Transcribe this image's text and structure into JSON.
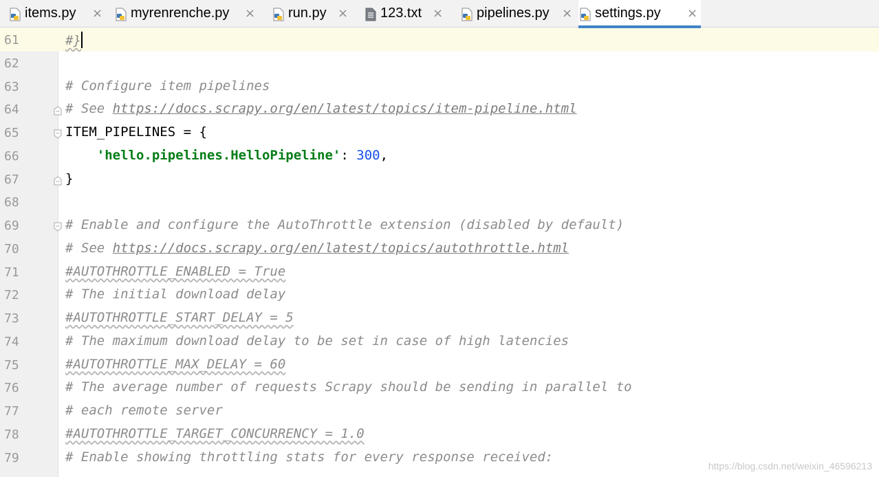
{
  "tabs": [
    {
      "label": "items.py",
      "icon": "python-file-icon",
      "active": false,
      "closable": true
    },
    {
      "label": "myrenrenche.py",
      "icon": "python-file-icon",
      "active": false,
      "closable": true
    },
    {
      "label": "run.py",
      "icon": "python-file-icon",
      "active": false,
      "closable": true
    },
    {
      "label": "123.txt",
      "icon": "text-file-icon",
      "active": false,
      "closable": true
    },
    {
      "label": "pipelines.py",
      "icon": "python-file-icon",
      "active": false,
      "closable": true
    },
    {
      "label": "settings.py",
      "icon": "python-file-icon",
      "active": true,
      "closable": true
    }
  ],
  "close_glyph": "×",
  "lines": [
    {
      "num": "61",
      "parts": [
        {
          "t": "#}",
          "c": "comment wavy"
        }
      ],
      "caret": true
    },
    {
      "num": "62",
      "parts": []
    },
    {
      "num": "63",
      "parts": [
        {
          "t": "# Configure item pipelines",
          "c": "comment"
        }
      ]
    },
    {
      "num": "64",
      "parts": [
        {
          "t": "# See ",
          "c": "comment"
        },
        {
          "t": "https://docs.scrapy.org/en/latest/topics/item-pipeline.html",
          "c": "url"
        }
      ],
      "fold": "end"
    },
    {
      "num": "65",
      "parts": [
        {
          "t": "ITEM_PIPELINES = {",
          "c": "plain"
        }
      ],
      "fold": "start"
    },
    {
      "num": "66",
      "parts": [
        {
          "t": "    ",
          "c": "plain"
        },
        {
          "t": "'hello.pipelines.HelloPipeline'",
          "c": "str"
        },
        {
          "t": ": ",
          "c": "plain"
        },
        {
          "t": "300",
          "c": "num"
        },
        {
          "t": ",",
          "c": "plain"
        }
      ]
    },
    {
      "num": "67",
      "parts": [
        {
          "t": "}",
          "c": "plain"
        }
      ],
      "fold": "end"
    },
    {
      "num": "68",
      "parts": []
    },
    {
      "num": "69",
      "parts": [
        {
          "t": "# Enable and configure the AutoThrottle extension (disabled by default)",
          "c": "comment"
        }
      ],
      "fold": "start"
    },
    {
      "num": "70",
      "parts": [
        {
          "t": "# See ",
          "c": "comment"
        },
        {
          "t": "https://docs.scrapy.org/en/latest/topics/autothrottle.html",
          "c": "url"
        }
      ]
    },
    {
      "num": "71",
      "parts": [
        {
          "t": "#AUTOTHROTTLE_ENABLED = True",
          "c": "comment wavy"
        }
      ]
    },
    {
      "num": "72",
      "parts": [
        {
          "t": "# The initial download delay",
          "c": "comment"
        }
      ]
    },
    {
      "num": "73",
      "parts": [
        {
          "t": "#AUTOTHROTTLE_START_DELAY = 5",
          "c": "comment wavy"
        }
      ]
    },
    {
      "num": "74",
      "parts": [
        {
          "t": "# The maximum download delay to be set in case of high latencies",
          "c": "comment"
        }
      ]
    },
    {
      "num": "75",
      "parts": [
        {
          "t": "#AUTOTHROTTLE_MAX_DELAY = 60",
          "c": "comment wavy"
        }
      ]
    },
    {
      "num": "76",
      "parts": [
        {
          "t": "# The average number of requests Scrapy should be sending in parallel to",
          "c": "comment"
        }
      ]
    },
    {
      "num": "77",
      "parts": [
        {
          "t": "# each remote server",
          "c": "comment"
        }
      ]
    },
    {
      "num": "78",
      "parts": [
        {
          "t": "#AUTOTHROTTLE_TARGET_CONCURRENCY = 1.0",
          "c": "comment wavy"
        }
      ]
    },
    {
      "num": "79",
      "parts": [
        {
          "t": "# Enable showing throttling stats for every response received:",
          "c": "comment"
        }
      ]
    }
  ],
  "watermark": "https://blog.csdn.net/weixin_46596213"
}
